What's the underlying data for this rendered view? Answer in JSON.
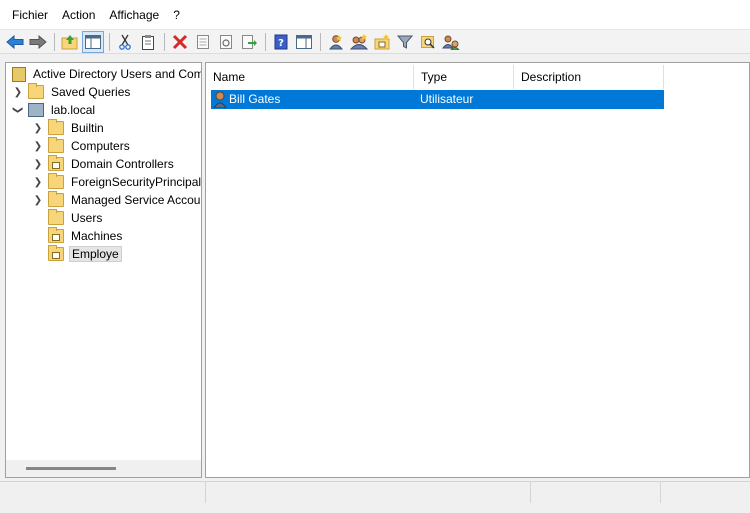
{
  "menu": [
    "Fichier",
    "Action",
    "Affichage",
    "?"
  ],
  "toolbar": {
    "buttons": [
      "back-arrow-icon",
      "forward-arrow-icon",
      "up-folder-icon",
      "show-hide-console-tree-icon",
      "cut-icon",
      "clipboard-icon",
      "delete-icon",
      "properties-icon",
      "refresh-icon",
      "export-list-icon",
      "help-icon",
      "action-pane-icon",
      "new-user-icon",
      "new-group-icon",
      "new-ou-icon",
      "filter-icon",
      "find-icon",
      "add-to-group-icon"
    ]
  },
  "tree": {
    "root": "Active Directory Users and Com",
    "saved_queries": "Saved Queries",
    "domain": "lab.local",
    "children": [
      "Builtin",
      "Computers",
      "Domain Controllers",
      "ForeignSecurityPrincipals",
      "Managed Service Accour",
      "Users",
      "Machines",
      "Employe"
    ],
    "selected": "Employe"
  },
  "list": {
    "columns": [
      "Name",
      "Type",
      "Description"
    ],
    "rows": [
      {
        "name": "Bill Gates",
        "type": "Utilisateur",
        "description": ""
      }
    ]
  },
  "colors": {
    "selection": "#0078d7",
    "folder": "#f7d57a"
  }
}
